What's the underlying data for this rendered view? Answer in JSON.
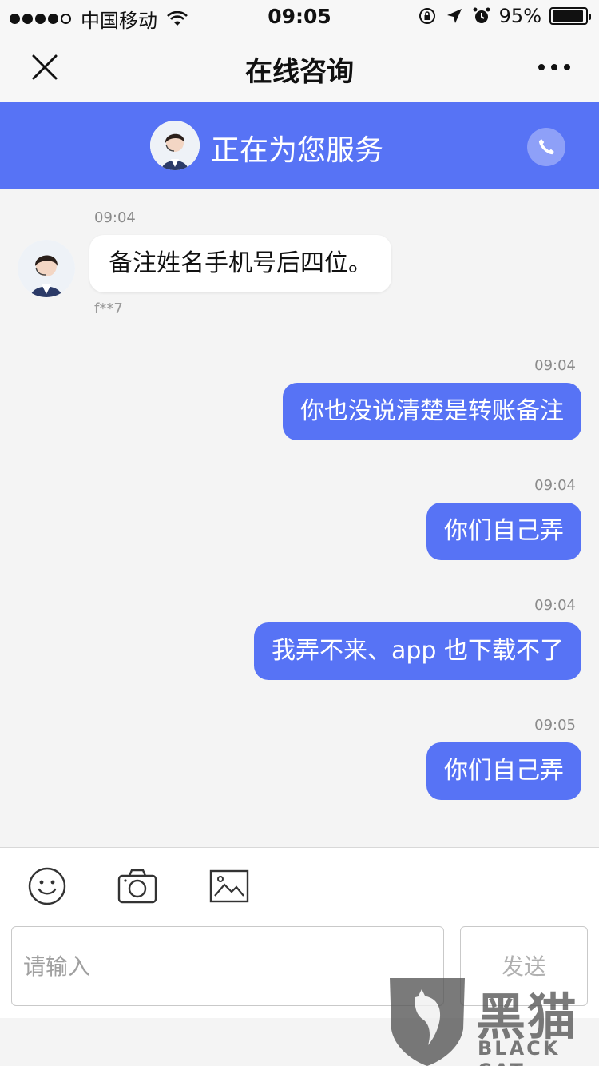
{
  "status_bar": {
    "carrier": "中国移动",
    "time": "09:05",
    "battery": "95%",
    "battery_level": 0.95
  },
  "nav": {
    "title": "在线咨询"
  },
  "service": {
    "title": "正在为您服务"
  },
  "messages": [
    {
      "direction": "in",
      "time": "09:04",
      "text": "备注姓名手机号后四位。",
      "sender": "f**7"
    },
    {
      "direction": "out",
      "time": "09:04",
      "text": "你也没说清楚是转账备注"
    },
    {
      "direction": "out",
      "time": "09:04",
      "text": "你们自己弄"
    },
    {
      "direction": "out",
      "time": "09:04",
      "text": "我弄不来、app 也下载不了"
    },
    {
      "direction": "out",
      "time": "09:05",
      "text": "你们自己弄"
    }
  ],
  "input": {
    "placeholder": "请输入",
    "send_label": "发送"
  },
  "watermark": {
    "cn": "黑猫",
    "en": "BLACK CAT"
  },
  "colors": {
    "accent": "#5773f5"
  },
  "icons": [
    "close-icon",
    "more-icon",
    "phone-icon",
    "emoji-icon",
    "camera-icon",
    "image-icon",
    "wifi-icon",
    "lock-rotation-icon",
    "location-arrow-icon",
    "alarm-icon"
  ]
}
